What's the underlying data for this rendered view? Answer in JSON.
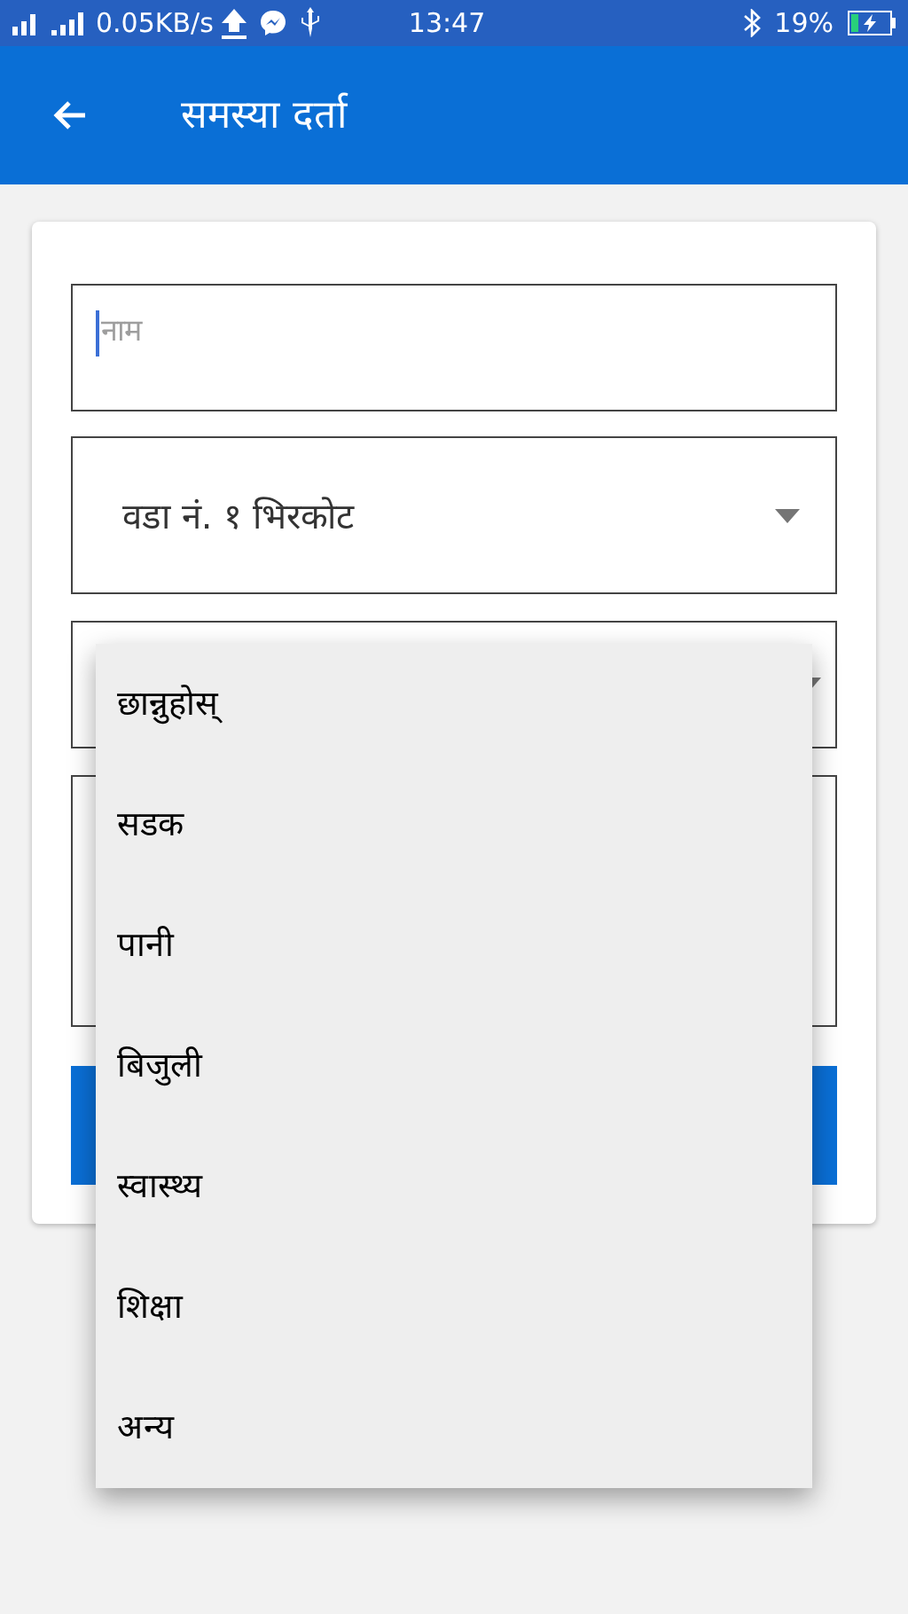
{
  "status_bar": {
    "speed": "0.05KB/s",
    "time": "13:47",
    "battery": "19%"
  },
  "app_bar": {
    "title": "समस्या दर्ता"
  },
  "form": {
    "name_field": {
      "placeholder": "नाम"
    },
    "ward_select": {
      "value": "वडा नं. १ भिरकोट"
    }
  },
  "dropdown_menu": {
    "items": [
      {
        "label": "छान्नुहोस्"
      },
      {
        "label": "सडक"
      },
      {
        "label": "पानी"
      },
      {
        "label": "बिजुली"
      },
      {
        "label": "स्वास्थ्य"
      },
      {
        "label": "शिक्षा"
      },
      {
        "label": "अन्य"
      }
    ]
  }
}
